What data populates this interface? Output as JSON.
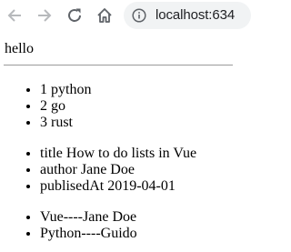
{
  "browser": {
    "url": "localhost:634",
    "icons": {
      "back": "arrow-left-icon",
      "forward": "arrow-right-icon",
      "reload": "reload-icon",
      "home": "home-icon",
      "site_info": "info-icon"
    }
  },
  "page": {
    "heading": "hello",
    "languages": [
      "1 python",
      "2 go",
      "3 rust"
    ],
    "book": [
      "title How to do lists in Vue",
      "author Jane Doe",
      "publisedAt 2019-04-01"
    ],
    "pairs": [
      "Vue----Jane Doe",
      "Python----Guido"
    ]
  }
}
